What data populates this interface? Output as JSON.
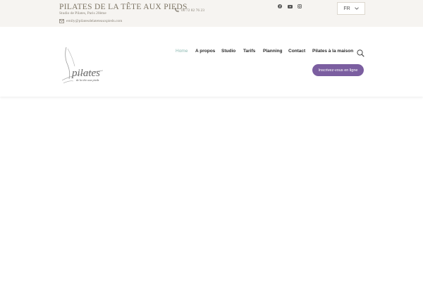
{
  "topbar": {
    "title": "PILATES DE LA TÊTE AUX PIEDS",
    "subtitle": "Studio de Pilates, Paris 20ème",
    "email": "emily@pilatesdelateteauxpieds.com",
    "phone": "06 72 82 76 23",
    "socials": [
      "facebook-icon",
      "youtube-icon",
      "instagram-icon"
    ],
    "language": "FR"
  },
  "nav": {
    "items": [
      "Home",
      "A propos",
      "Studio",
      "Tarifs",
      "Planning",
      "Contact",
      "Pilates à la maison"
    ],
    "active": "Home",
    "cta": "Inscrivez-vous en ligne"
  },
  "logo": {
    "word": "pilates",
    "tagline": "de la tête aux pieds"
  },
  "colors": {
    "topbar_bg": "#f6f4f1",
    "accent_active": "#8ab8b0",
    "cta_bg": "#7b5ea0"
  }
}
